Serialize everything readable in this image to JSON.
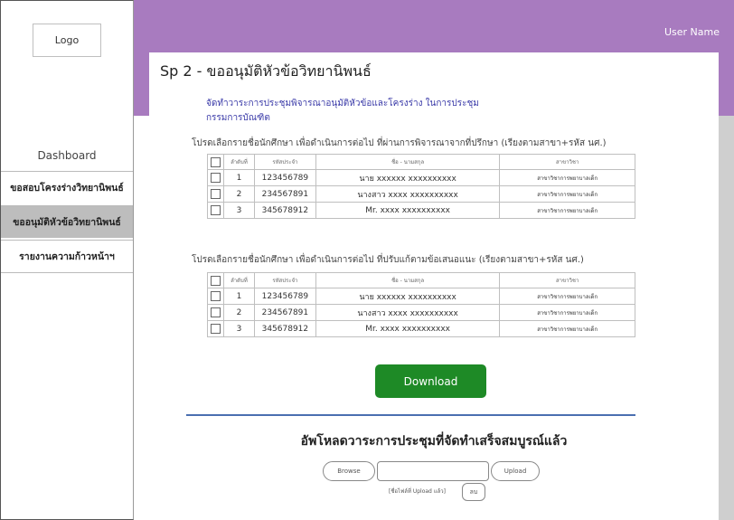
{
  "sidebar": {
    "logo": "Logo",
    "nav_label": "Dashboard",
    "items": [
      {
        "label": "ขอสอบโครงร่างวิทยานิพนธ์"
      },
      {
        "label": "ขออนุมัติหัวข้อวิทยานิพนธ์"
      },
      {
        "label": "รายงานความก้าวหน้าฯ"
      }
    ]
  },
  "header": {
    "user_name": "User Name"
  },
  "main": {
    "title": "Sp 2 - ขออนุมัติหัวข้อวิทยานิพนธ์",
    "desc_line1": "จัดทำวาระการประชุมพิจารณาอนุมัติหัวข้อและโครงร่าง ในการประชุม",
    "desc_line2": "กรรมการบัณฑิต",
    "section1_note": "โปรดเลือกรายชื่อนักศึกษา เพื่อดำเนินการต่อไป ที่ผ่านการพิจารณาจากที่ปรึกษา (เรียงตามสาขา+รหัส นศ.)",
    "section2_note": "โปรดเลือกรายชื่อนักศึกษา เพื่อดำเนินการต่อไป ที่ปรับแก้ตามข้อเสนอแนะ (เรียงตามสาขา+รหัส นศ.)",
    "columns": {
      "seq": "ลำดับที่",
      "id": "รหัสประจำ",
      "name": "ชื่อ - นามสกุล",
      "major": "สาขาวิชา"
    },
    "table1": [
      {
        "seq": "1",
        "id": "123456789",
        "name": "นาย xxxxxx   xxxxxxxxxx",
        "major": "สาขาวิชาการพยาบาลเด็ก"
      },
      {
        "seq": "2",
        "id": "234567891",
        "name": "นางสาว xxxx   xxxxxxxxxx",
        "major": "สาขาวิชาการพยาบาลเด็ก"
      },
      {
        "seq": "3",
        "id": "345678912",
        "name": "Mr. xxxx   xxxxxxxxxx",
        "major": "สาขาวิชาการพยาบาลเด็ก"
      }
    ],
    "table2": [
      {
        "seq": "1",
        "id": "123456789",
        "name": "นาย xxxxxx   xxxxxxxxxx",
        "major": "สาขาวิชาการพยาบาลเด็ก"
      },
      {
        "seq": "2",
        "id": "234567891",
        "name": "นางสาว xxxx   xxxxxxxxxx",
        "major": "สาขาวิชาการพยาบาลเด็ก"
      },
      {
        "seq": "3",
        "id": "345678912",
        "name": "Mr. xxxx   xxxxxxxxxx",
        "major": "สาขาวิชาการพยาบาลเด็ก"
      }
    ],
    "download_label": "Download",
    "upload_title": "อัพโหลดวาระการประชุมที่จัดทำเสร็จสมบูรณ์แล้ว",
    "browse_label": "Browse",
    "upload_label": "Upload",
    "file_note": "[ชื่อไฟล์ที่ Upload แล้ว]",
    "delete_label": "ลบ"
  },
  "colors": {
    "header": "#a87bbf",
    "download": "#1e8a26",
    "divider": "#4a6fb0",
    "active_nav": "#bdbdbd"
  }
}
